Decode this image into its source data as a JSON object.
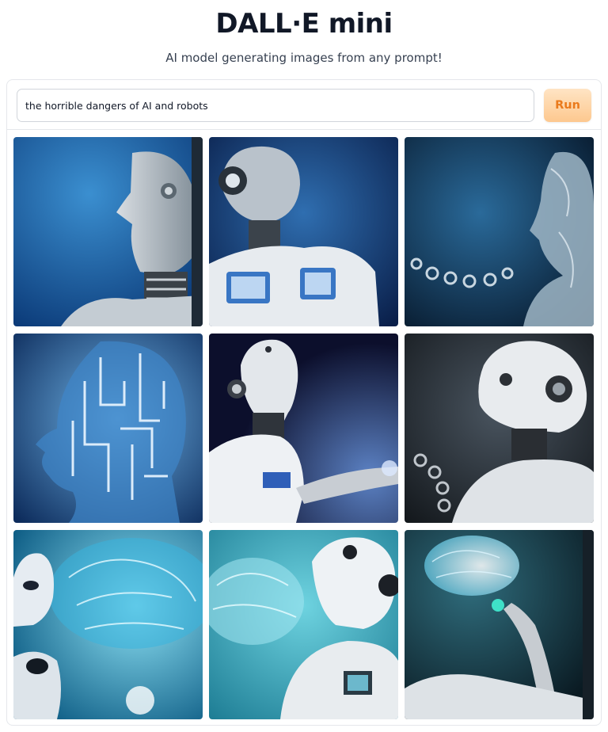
{
  "app": {
    "title": "DALL·E mini",
    "subtitle": "AI model generating images from any prompt!"
  },
  "prompt": {
    "value": "the horrible dangers of AI and robots",
    "run_label": "Run"
  },
  "gallery": {
    "images": [
      {
        "name": "robot-profile-blue"
      },
      {
        "name": "robot-with-chest-screens"
      },
      {
        "name": "glass-head-chain"
      },
      {
        "name": "circuit-head-profile"
      },
      {
        "name": "white-robot-reaching"
      },
      {
        "name": "robot-with-chain"
      },
      {
        "name": "alien-robot-glowing-brain"
      },
      {
        "name": "robot-beside-brain"
      },
      {
        "name": "robot-hand-holding-brain"
      }
    ]
  }
}
